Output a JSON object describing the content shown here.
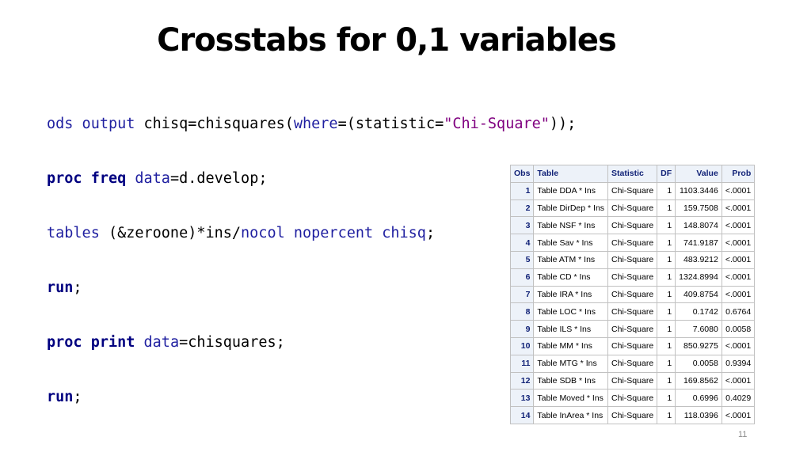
{
  "slide": {
    "title": "Crosstabs for 0,1 variables",
    "page_number": "11"
  },
  "code": {
    "line1": {
      "t1": "ods output",
      "t2": " chisq=chisquares(",
      "t3": "where",
      "t4": "=(statistic=",
      "t5": "\"Chi-Square\"",
      "t6": "));"
    },
    "line2": {
      "t1": "proc freq",
      "t2": " ",
      "t3": "data",
      "t4": "=d.develop;"
    },
    "line3": {
      "t1": "tables",
      "t2": " (&zeroone)*ins/",
      "t3": "nocol nopercent chisq",
      "t4": ";"
    },
    "line4": {
      "t1": "run",
      "t2": ";"
    },
    "line5": {
      "t1": "proc print",
      "t2": " ",
      "t3": "data",
      "t4": "=chisquares;"
    },
    "line6": {
      "t1": "run",
      "t2": ";"
    }
  },
  "table": {
    "headers": {
      "obs": "Obs",
      "table": "Table",
      "statistic": "Statistic",
      "df": "DF",
      "value": "Value",
      "prob": "Prob"
    },
    "rows": [
      {
        "obs": "1",
        "table": "Table DDA * Ins",
        "statistic": "Chi-Square",
        "df": "1",
        "value": "1103.3446",
        "prob": "<.0001"
      },
      {
        "obs": "2",
        "table": "Table DirDep * Ins",
        "statistic": "Chi-Square",
        "df": "1",
        "value": "159.7508",
        "prob": "<.0001"
      },
      {
        "obs": "3",
        "table": "Table NSF * Ins",
        "statistic": "Chi-Square",
        "df": "1",
        "value": "148.8074",
        "prob": "<.0001"
      },
      {
        "obs": "4",
        "table": "Table Sav * Ins",
        "statistic": "Chi-Square",
        "df": "1",
        "value": "741.9187",
        "prob": "<.0001"
      },
      {
        "obs": "5",
        "table": "Table ATM * Ins",
        "statistic": "Chi-Square",
        "df": "1",
        "value": "483.9212",
        "prob": "<.0001"
      },
      {
        "obs": "6",
        "table": "Table CD * Ins",
        "statistic": "Chi-Square",
        "df": "1",
        "value": "1324.8994",
        "prob": "<.0001"
      },
      {
        "obs": "7",
        "table": "Table IRA * Ins",
        "statistic": "Chi-Square",
        "df": "1",
        "value": "409.8754",
        "prob": "<.0001"
      },
      {
        "obs": "8",
        "table": "Table LOC * Ins",
        "statistic": "Chi-Square",
        "df": "1",
        "value": "0.1742",
        "prob": "0.6764"
      },
      {
        "obs": "9",
        "table": "Table ILS * Ins",
        "statistic": "Chi-Square",
        "df": "1",
        "value": "7.6080",
        "prob": "0.0058"
      },
      {
        "obs": "10",
        "table": "Table MM * Ins",
        "statistic": "Chi-Square",
        "df": "1",
        "value": "850.9275",
        "prob": "<.0001"
      },
      {
        "obs": "11",
        "table": "Table MTG * Ins",
        "statistic": "Chi-Square",
        "df": "1",
        "value": "0.0058",
        "prob": "0.9394"
      },
      {
        "obs": "12",
        "table": "Table SDB * Ins",
        "statistic": "Chi-Square",
        "df": "1",
        "value": "169.8562",
        "prob": "<.0001"
      },
      {
        "obs": "13",
        "table": "Table Moved * Ins",
        "statistic": "Chi-Square",
        "df": "1",
        "value": "0.6996",
        "prob": "0.4029"
      },
      {
        "obs": "14",
        "table": "Table InArea * Ins",
        "statistic": "Chi-Square",
        "df": "1",
        "value": "118.0396",
        "prob": "<.0001"
      }
    ]
  },
  "colors": {
    "keyword": "#1f1fa0",
    "keyword_bold": "#000080",
    "string": "#800080",
    "header_bg": "#edf2f9",
    "header_text": "#112277"
  }
}
